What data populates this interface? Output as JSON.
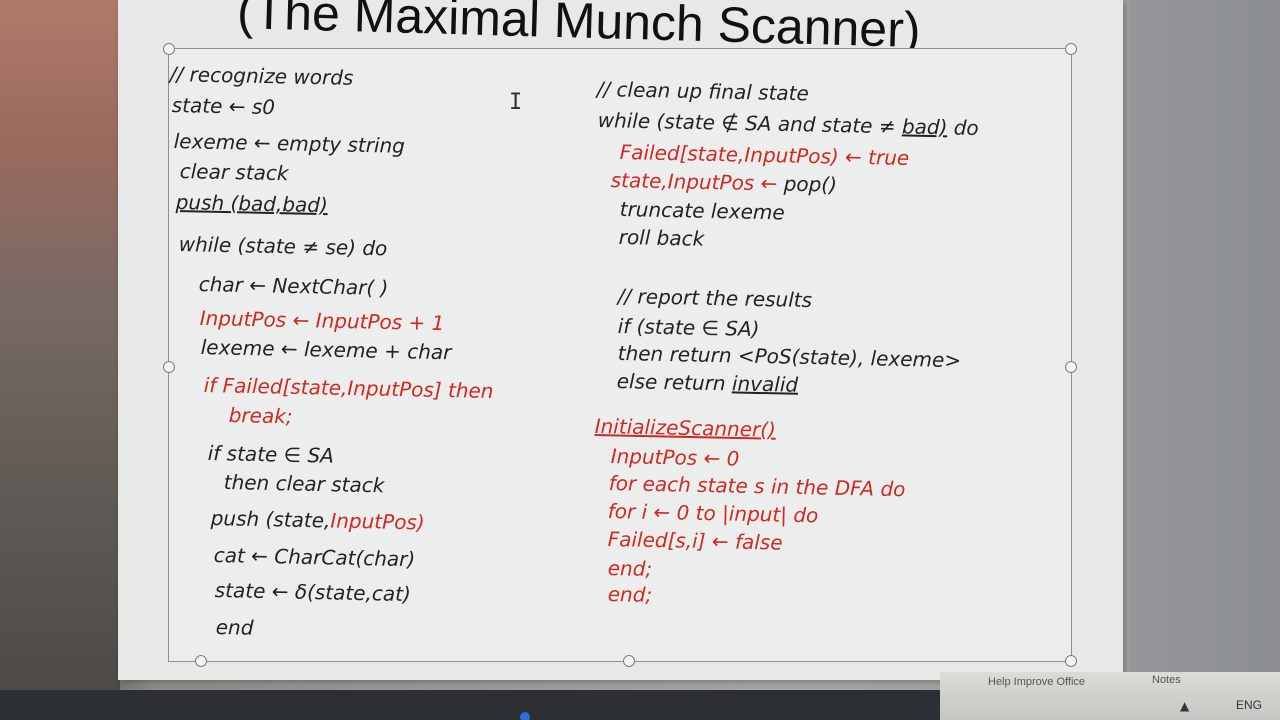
{
  "slide": {
    "title": "(The Maximal Munch Scanner)",
    "left_column": [
      {
        "text": "// recognize words",
        "color": "black"
      },
      {
        "text": "state ← s0",
        "color": "black"
      },
      {
        "text": "lexeme ← empty string",
        "color": "black"
      },
      {
        "text": "clear stack",
        "color": "black"
      },
      {
        "text": "push (bad,bad)",
        "color": "black"
      },
      {
        "text": "while (state ≠ se) do",
        "color": "black"
      },
      {
        "text": "char ← NextChar( )",
        "color": "black"
      },
      {
        "text": "InputPos ← InputPos + 1",
        "color": "red"
      },
      {
        "text": "lexeme ← lexeme + char",
        "color": "black"
      },
      {
        "text": "if Failed[state,InputPos] then",
        "color": "red"
      },
      {
        "text": "break;",
        "color": "red"
      },
      {
        "text": "if state ∈ SA",
        "color": "black"
      },
      {
        "text": "then clear stack",
        "color": "black"
      },
      {
        "text": "push (state,",
        "color": "black"
      },
      {
        "text": "InputPos)",
        "color": "red"
      },
      {
        "text": "cat ← CharCat(char)",
        "color": "black"
      },
      {
        "text": "state ← δ(state,cat)",
        "color": "black"
      },
      {
        "text": "end",
        "color": "black"
      }
    ],
    "right_column": [
      {
        "text": "// clean up final state",
        "color": "black"
      },
      {
        "text": "while (state ∉ SA and state ≠ ",
        "color": "black"
      },
      {
        "text": "bad)",
        "color": "black"
      },
      {
        "text": " do",
        "color": "black"
      },
      {
        "text": "Failed[state,InputPos) ← true",
        "color": "red"
      },
      {
        "text": "state,InputPos ← ",
        "color": "red"
      },
      {
        "text": "pop()",
        "color": "black"
      },
      {
        "text": "truncate lexeme",
        "color": "black"
      },
      {
        "text": "roll back",
        "color": "black"
      },
      {
        "text": "// report the results",
        "color": "black"
      },
      {
        "text": "if (state ∈ SA)",
        "color": "black"
      },
      {
        "text": "then return <PoS(state), lexeme>",
        "color": "black"
      },
      {
        "text": "else return ",
        "color": "black"
      },
      {
        "text": "invalid",
        "color": "black"
      },
      {
        "text": "InitializeScanner()",
        "color": "red"
      },
      {
        "text": "InputPos ← 0",
        "color": "red"
      },
      {
        "text": "for each state s in the DFA do",
        "color": "red"
      },
      {
        "text": "for i ← 0 to |input| do",
        "color": "red"
      },
      {
        "text": "Failed[s,i] ← false",
        "color": "red"
      },
      {
        "text": "end;",
        "color": "red"
      },
      {
        "text": "end;",
        "color": "red"
      }
    ]
  },
  "status_bar": {
    "help_text": "Help Improve Office",
    "notes_label": "Notes",
    "language": "ENG"
  },
  "icons": {
    "cursor": "text-cursor-icon",
    "tray": "chevron-up-icon"
  },
  "colors": {
    "code_black": "#222222",
    "code_red": "#d2281f",
    "slide_bg": "#eceeee"
  }
}
